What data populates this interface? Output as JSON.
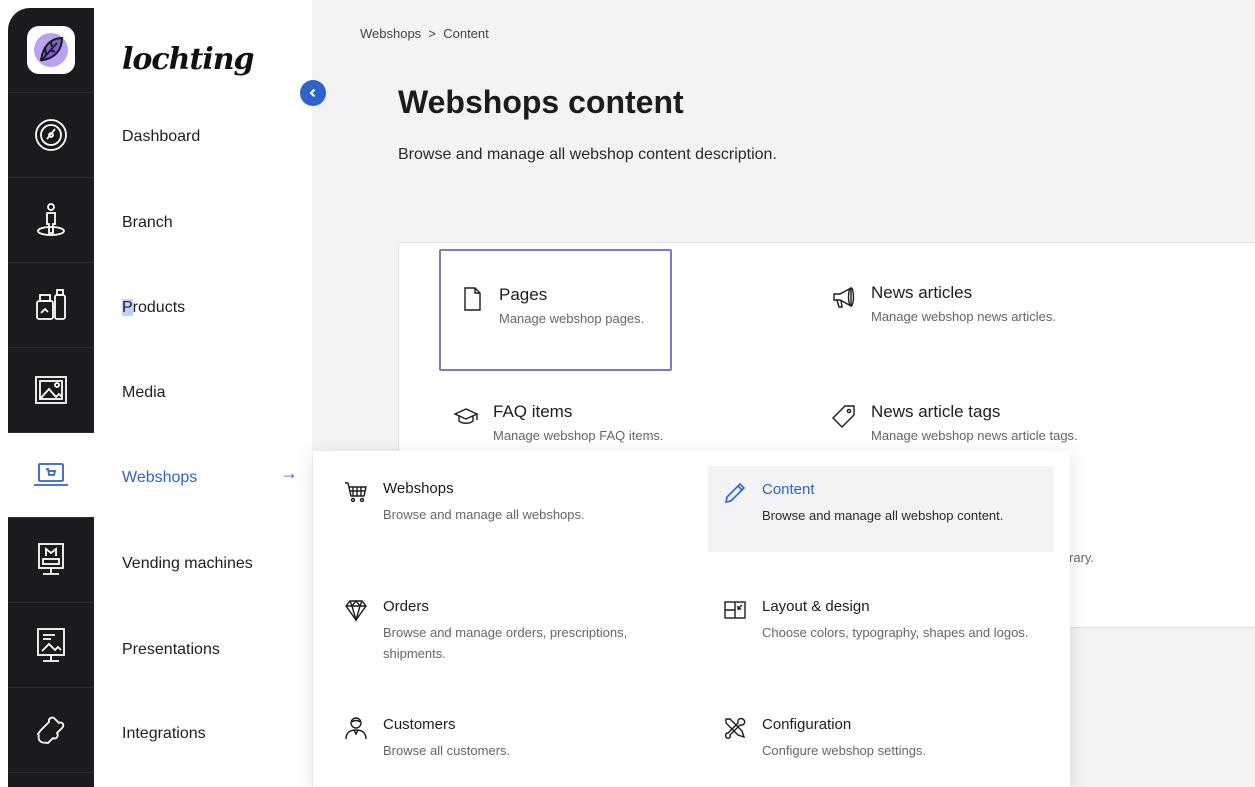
{
  "colors": {
    "accent": "#2f63c9",
    "rail_bg": "#1b1b1f",
    "selection_border": "#8a73c9"
  },
  "rail": {
    "logo_icon": "leaf-logo-icon",
    "items": [
      {
        "icon": "dashboard-gauge-icon"
      },
      {
        "icon": "branch-location-icon"
      },
      {
        "icon": "products-icon"
      },
      {
        "icon": "media-image-icon"
      },
      {
        "icon": "webshop-laptop-icon",
        "active": true
      },
      {
        "icon": "vending-machine-icon"
      },
      {
        "icon": "presentation-icon"
      },
      {
        "icon": "integrations-puzzle-icon"
      }
    ]
  },
  "nav": {
    "brand": "lochting",
    "items": [
      {
        "label": "Dashboard"
      },
      {
        "label": "Branch"
      },
      {
        "label_first": "P",
        "label_rest": "roducts"
      },
      {
        "label": "Media"
      },
      {
        "label": "Webshops",
        "active": true
      },
      {
        "label": "Vending machines"
      },
      {
        "label": "Presentations"
      },
      {
        "label": "Integrations"
      }
    ],
    "arrow": "→"
  },
  "main": {
    "breadcrumb": "Webshops  >  Content",
    "title": "Webshops content",
    "subtitle": "Browse and manage all webshop content description.",
    "tiles": [
      {
        "title": "Pages",
        "desc": "Manage webshop pages.",
        "icon": "page-icon"
      },
      {
        "title": "News articles",
        "desc": "Manage webshop news articles.",
        "icon": "megaphone-icon"
      },
      {
        "title": "FAQ items",
        "desc": "Manage webshop FAQ items.",
        "icon": "graduation-cap-icon"
      },
      {
        "title": "News article tags",
        "desc": "Manage webshop news article tags.",
        "icon": "tag-icon"
      }
    ],
    "partially_hidden_text": "library."
  },
  "flyout": {
    "items": [
      {
        "title": "Webshops",
        "desc": "Browse and manage all webshops.",
        "icon": "cart-icon"
      },
      {
        "title": "Content",
        "desc": "Browse and manage all webshop content.",
        "icon": "pencil-icon",
        "active": true
      },
      {
        "title": "Orders",
        "desc": "Browse and manage orders, prescriptions, shipments.",
        "icon": "diamond-icon"
      },
      {
        "title": "Layout & design",
        "desc": "Choose colors, typography, shapes and logos.",
        "icon": "layout-icon"
      },
      {
        "title": "Customers",
        "desc": "Browse all customers.",
        "icon": "customer-icon"
      },
      {
        "title": "Configuration",
        "desc": "Configure webshop settings.",
        "icon": "tools-icon"
      }
    ]
  }
}
